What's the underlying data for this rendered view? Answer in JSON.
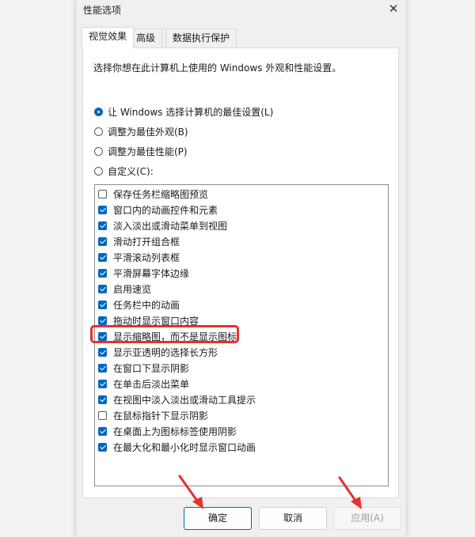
{
  "window": {
    "title": "性能选项",
    "close_glyph": "✕"
  },
  "tabs": [
    {
      "label": "视觉效果",
      "active": true
    },
    {
      "label": "高级",
      "active": false
    },
    {
      "label": "数据执行保护",
      "active": false
    }
  ],
  "description": "选择你想在此计算机上使用的 Windows 外观和性能设置。",
  "radios": [
    {
      "label": "让 Windows 选择计算机的最佳设置(L)",
      "selected": true
    },
    {
      "label": "调整为最佳外观(B)",
      "selected": false
    },
    {
      "label": "调整为最佳性能(P)",
      "selected": false
    },
    {
      "label": "自定义(C):",
      "selected": false
    }
  ],
  "effects": [
    {
      "label": "保存任务栏缩略图预览",
      "checked": false
    },
    {
      "label": "窗口内的动画控件和元素",
      "checked": true
    },
    {
      "label": "淡入淡出或滑动菜单到视图",
      "checked": true
    },
    {
      "label": "滑动打开组合框",
      "checked": true
    },
    {
      "label": "平滑滚动列表框",
      "checked": true
    },
    {
      "label": "平滑屏幕字体边缘",
      "checked": true
    },
    {
      "label": "启用速览",
      "checked": true
    },
    {
      "label": "任务栏中的动画",
      "checked": true
    },
    {
      "label": "拖动时显示窗口内容",
      "checked": true
    },
    {
      "label": "显示缩略图，而不是显示图标",
      "checked": true
    },
    {
      "label": "显示亚透明的选择长方形",
      "checked": true
    },
    {
      "label": "在窗口下显示阴影",
      "checked": true
    },
    {
      "label": "在单击后淡出菜单",
      "checked": true
    },
    {
      "label": "在视图中淡入淡出或滑动工具提示",
      "checked": true
    },
    {
      "label": "在鼠标指针下显示阴影",
      "checked": false
    },
    {
      "label": "在桌面上为图标标签使用阴影",
      "checked": true
    },
    {
      "label": "在最大化和最小化时显示窗口动画",
      "checked": true
    }
  ],
  "buttons": {
    "ok": "确定",
    "cancel": "取消",
    "apply": "应用(A)"
  },
  "annotation": {
    "highlight_color": "#e5312f",
    "arrow_color": "#e5312f"
  },
  "colors": {
    "accent": "#0067c0"
  }
}
